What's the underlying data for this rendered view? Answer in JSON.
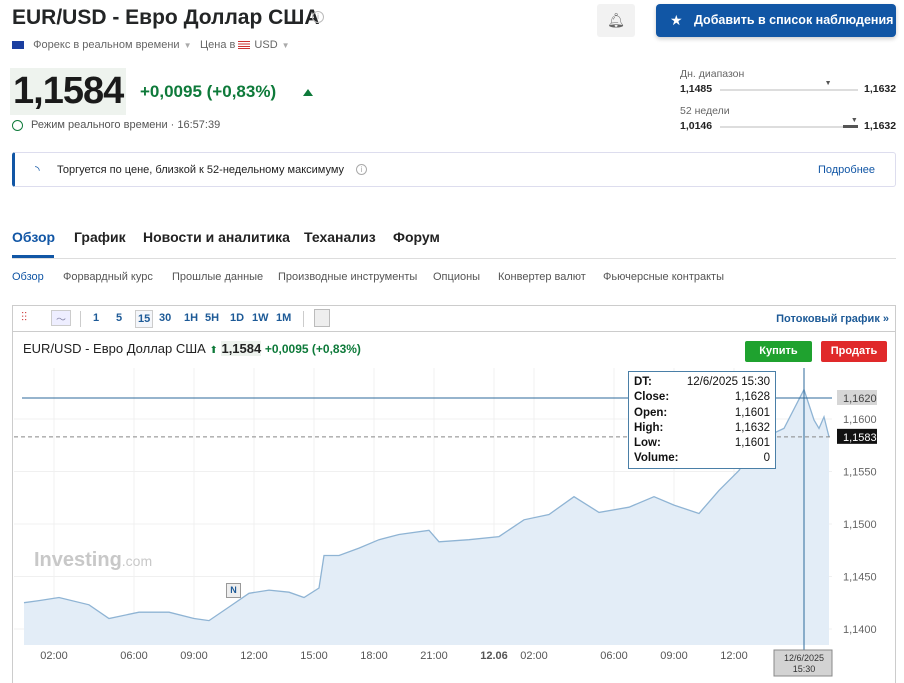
{
  "header": {
    "title": "EUR/USD - Евро Доллар США",
    "market": "Форекс в реальном времени",
    "price_in_label": "Цена в",
    "currency": "USD",
    "price": "1,1584",
    "change": "+0,0095 (+0,83%)",
    "realtime_label": "Режим реального времени · 16:57:39",
    "watchlist_button": "Добавить в список наблюдения",
    "up_color": "#0e7a3a",
    "accent": "#1156a5"
  },
  "ranges": {
    "day": {
      "label": "Дн. диапазон",
      "low": "1,1485",
      "high": "1,1632",
      "position": 0.78
    },
    "week52": {
      "label": "52 недели",
      "low": "1,0146",
      "high": "1,1632",
      "position": 0.97
    }
  },
  "notice": {
    "text": "Торгуется по цене, близкой к 52-недельному максимуму",
    "link": "Подробнее"
  },
  "tabs": [
    "Обзор",
    "График",
    "Новости и аналитика",
    "Теханализ",
    "Форум"
  ],
  "subtabs": [
    "Обзор",
    "Форвардный курс",
    "Прошлые данные",
    "Производные инструменты",
    "Опционы",
    "Конвертер валют",
    "Фьючерсные контракты"
  ],
  "chart": {
    "timeframes": [
      "1",
      "5",
      "15",
      "30",
      "1H",
      "5H",
      "1D",
      "1W",
      "1M"
    ],
    "active_timeframe": "15",
    "stream_link": "Потоковый график »",
    "title": "EUR/USD - Евро Доллар США",
    "price": "1,1584",
    "change": "+0,0095 (+0,83%)",
    "buy": "Купить",
    "sell": "Продать",
    "watermark": "Investing",
    "watermark_suffix": ".com",
    "news_marker": "N",
    "tooltip": {
      "DT": "12/6/2025 15:30",
      "Close": "1,1628",
      "Open": "1,1601",
      "High": "1,1632",
      "Low": "1,1601",
      "Volume": "0"
    },
    "cursor_label": [
      "12/6/2025",
      "15:30"
    ]
  },
  "chart_data": {
    "type": "area",
    "ylim": [
      1.1385,
      1.1645
    ],
    "y_ticks": [
      "1,1400",
      "1,1450",
      "1,1500",
      "1,1550",
      "1,1600"
    ],
    "y_tick_values": [
      1.14,
      1.145,
      1.15,
      1.155,
      1.16
    ],
    "x_ticks": [
      [
        "2025-12-05T02:00",
        "02:00"
      ],
      [
        "2025-12-05T06:00",
        "06:00"
      ],
      [
        "2025-12-05T09:00",
        "09:00"
      ],
      [
        "2025-12-05T12:00",
        "12:00"
      ],
      [
        "2025-12-05T15:00",
        "15:00"
      ],
      [
        "2025-12-05T18:00",
        "18:00"
      ],
      [
        "2025-12-05T21:00",
        "21:00"
      ],
      [
        "2025-12-06T00:00",
        "12.06"
      ],
      [
        "2025-12-06T02:00",
        "02:00"
      ],
      [
        "2025-12-06T06:00",
        "06:00"
      ],
      [
        "2025-12-06T09:00",
        "09:00"
      ],
      [
        "2025-12-06T12:00",
        "12:00"
      ]
    ],
    "crosshair_value": "1,1620",
    "last_value": "1,1583",
    "last": 1.1583,
    "crosshair": 1.162,
    "cursor_time": "2025-12-06T15:30",
    "x": [
      "2025-12-05T00:30",
      "2025-12-05T01:15",
      "2025-12-05T02:15",
      "2025-12-05T03:45",
      "2025-12-05T04:45",
      "2025-12-05T06:15",
      "2025-12-05T07:45",
      "2025-12-05T09:00",
      "2025-12-05T09:45",
      "2025-12-05T10:45",
      "2025-12-05T11:45",
      "2025-12-05T12:45",
      "2025-12-05T13:45",
      "2025-12-05T14:30",
      "2025-12-05T15:15",
      "2025-12-05T15:30",
      "2025-12-05T16:15",
      "2025-12-05T17:15",
      "2025-12-05T18:15",
      "2025-12-05T19:15",
      "2025-12-05T20:45",
      "2025-12-05T21:15",
      "2025-12-05T22:45",
      "2025-12-06T00:15",
      "2025-12-06T01:30",
      "2025-12-06T02:45",
      "2025-12-06T04:00",
      "2025-12-06T05:15",
      "2025-12-06T06:45",
      "2025-12-06T08:00",
      "2025-12-06T09:00",
      "2025-12-06T10:15",
      "2025-12-06T11:15",
      "2025-12-06T12:15",
      "2025-12-06T13:15",
      "2025-12-06T14:30",
      "2025-12-06T15:30",
      "2025-12-06T16:00",
      "2025-12-06T16:15",
      "2025-12-06T16:30",
      "2025-12-06T16:45"
    ],
    "y": [
      1.1425,
      1.1427,
      1.143,
      1.1423,
      1.141,
      1.1416,
      1.1416,
      1.141,
      1.1408,
      1.1421,
      1.1434,
      1.1437,
      1.1435,
      1.143,
      1.1439,
      1.147,
      1.147,
      1.1477,
      1.1485,
      1.149,
      1.1494,
      1.1483,
      1.1485,
      1.1488,
      1.1504,
      1.1509,
      1.1526,
      1.1511,
      1.1516,
      1.1526,
      1.1518,
      1.151,
      1.1532,
      1.1551,
      1.158,
      1.1591,
      1.1628,
      1.1599,
      1.1591,
      1.1602,
      1.1583
    ],
    "line_color": "#8fb4d4",
    "fill_color": "#e3edf7"
  }
}
